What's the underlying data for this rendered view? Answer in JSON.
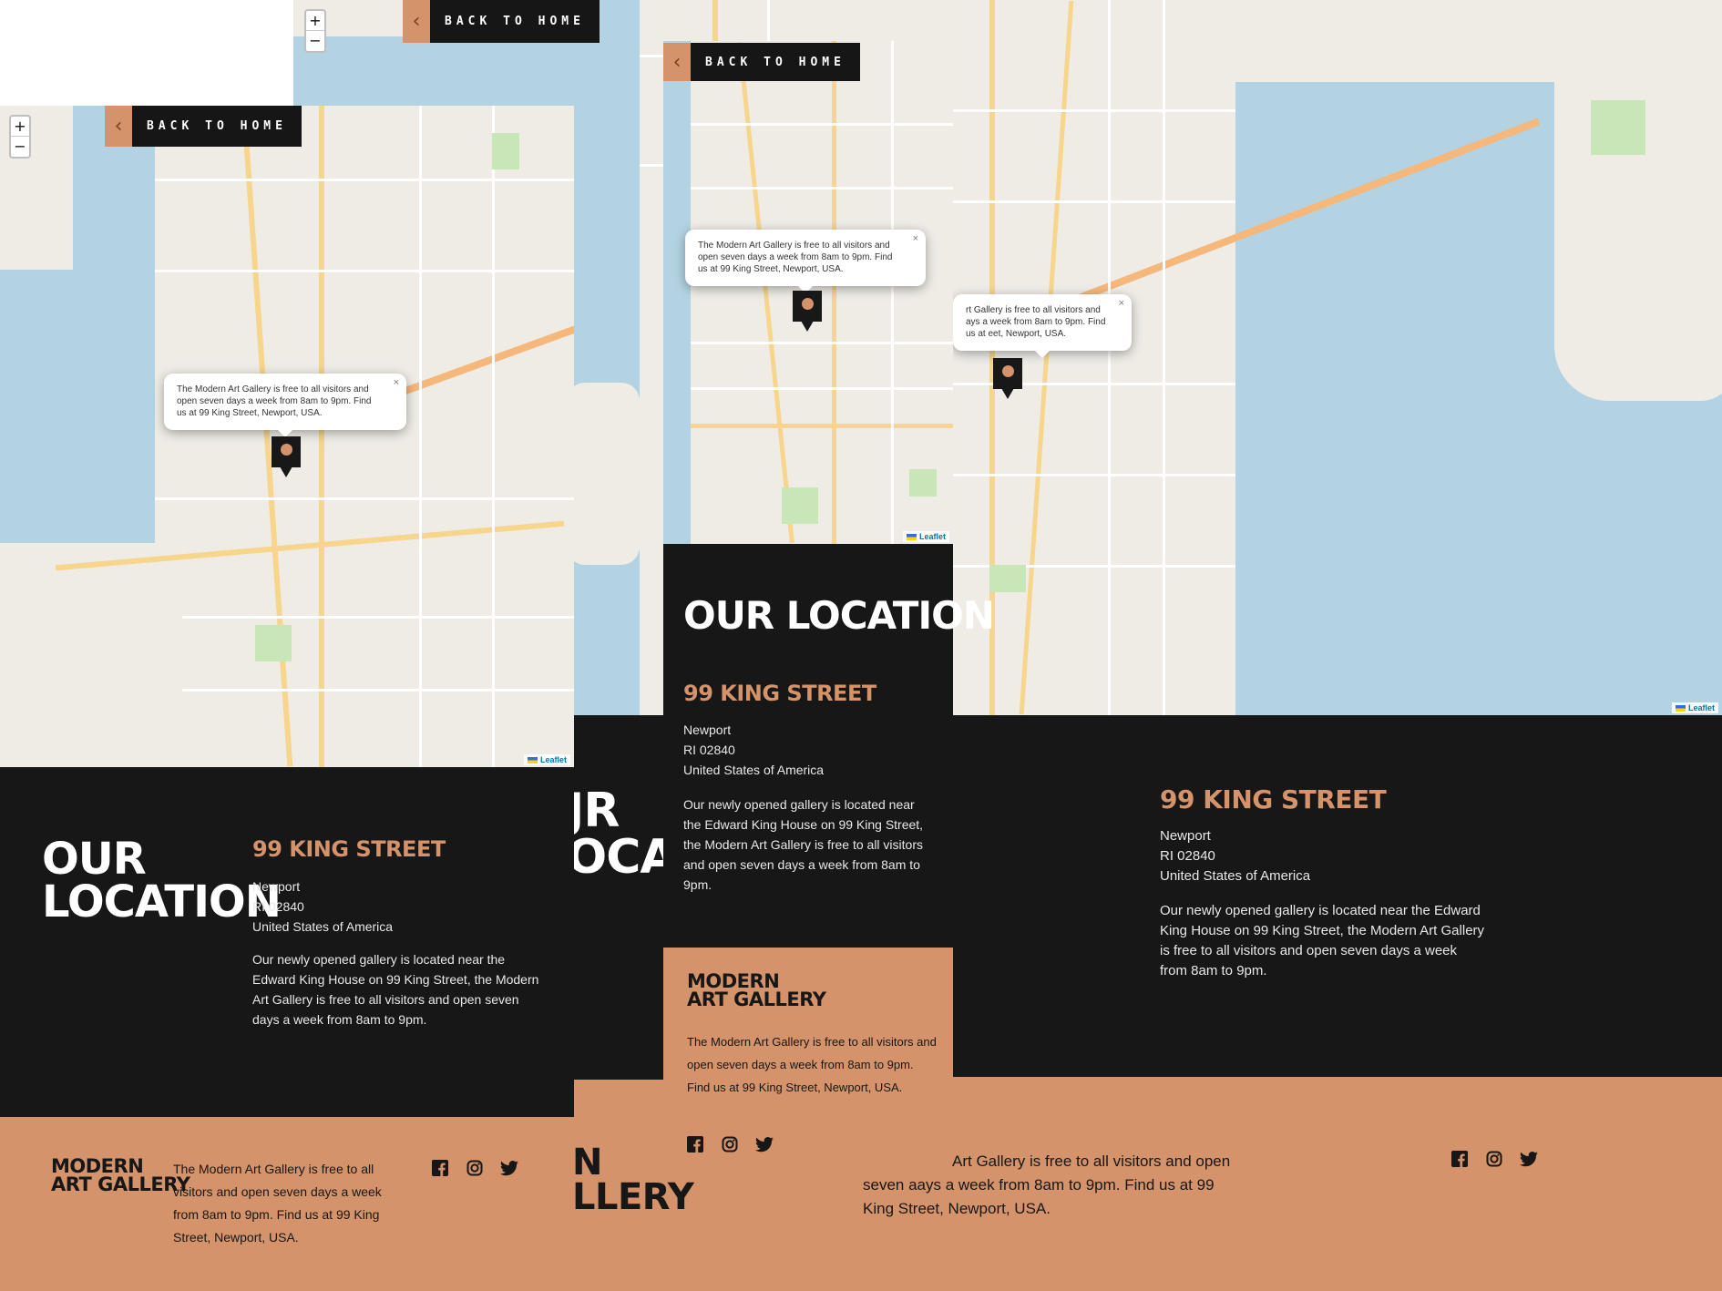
{
  "back_label": "BACK TO HOME",
  "zoom_in": "+",
  "zoom_out": "−",
  "popup_text": "The Modern Art Gallery is free to all visitors and open seven days a week from 8am to 9pm. Find us at 99 King Street, Newport, USA.",
  "popup_text_cut": "rt Gallery is free to all visitors and ays a week from 8am to 9pm. Find us at eet, Newport, USA.",
  "popup_close": "×",
  "attribution": "Leaflet",
  "location_title": "OUR LOCATION",
  "location_title_lines": [
    "OUR",
    "LOCATION"
  ],
  "location_title_partial": [
    "JR",
    "OCATI"
  ],
  "address": {
    "street": "99 KING STREET",
    "city": "Newport",
    "zip": "RI 02840",
    "country": "United States of America"
  },
  "description": "Our newly opened gallery is located near the Edward King House on 99 King Street, the Modern Art Gallery is free to all visitors and open seven days a week from 8am to 9pm.",
  "footer": {
    "brand_lines": [
      "MODERN",
      "ART GALLERY"
    ],
    "brand_partial": [
      "N",
      "LLERY"
    ],
    "text": "The Modern Art Gallery is free to all visitors and open seven days a week from 8am to 9pm. Find us at 99 King Street, Newport, USA.",
    "text_partial": "Art Gallery is free to all visitors and open seven aays a week from 8am to 9pm. Find us at 99 King Street, Newport, USA."
  },
  "social": [
    "facebook-icon",
    "instagram-icon",
    "twitter-icon"
  ],
  "colors": {
    "dark": "#171717",
    "accent": "#d4936a",
    "water": "#b3d3e3"
  }
}
